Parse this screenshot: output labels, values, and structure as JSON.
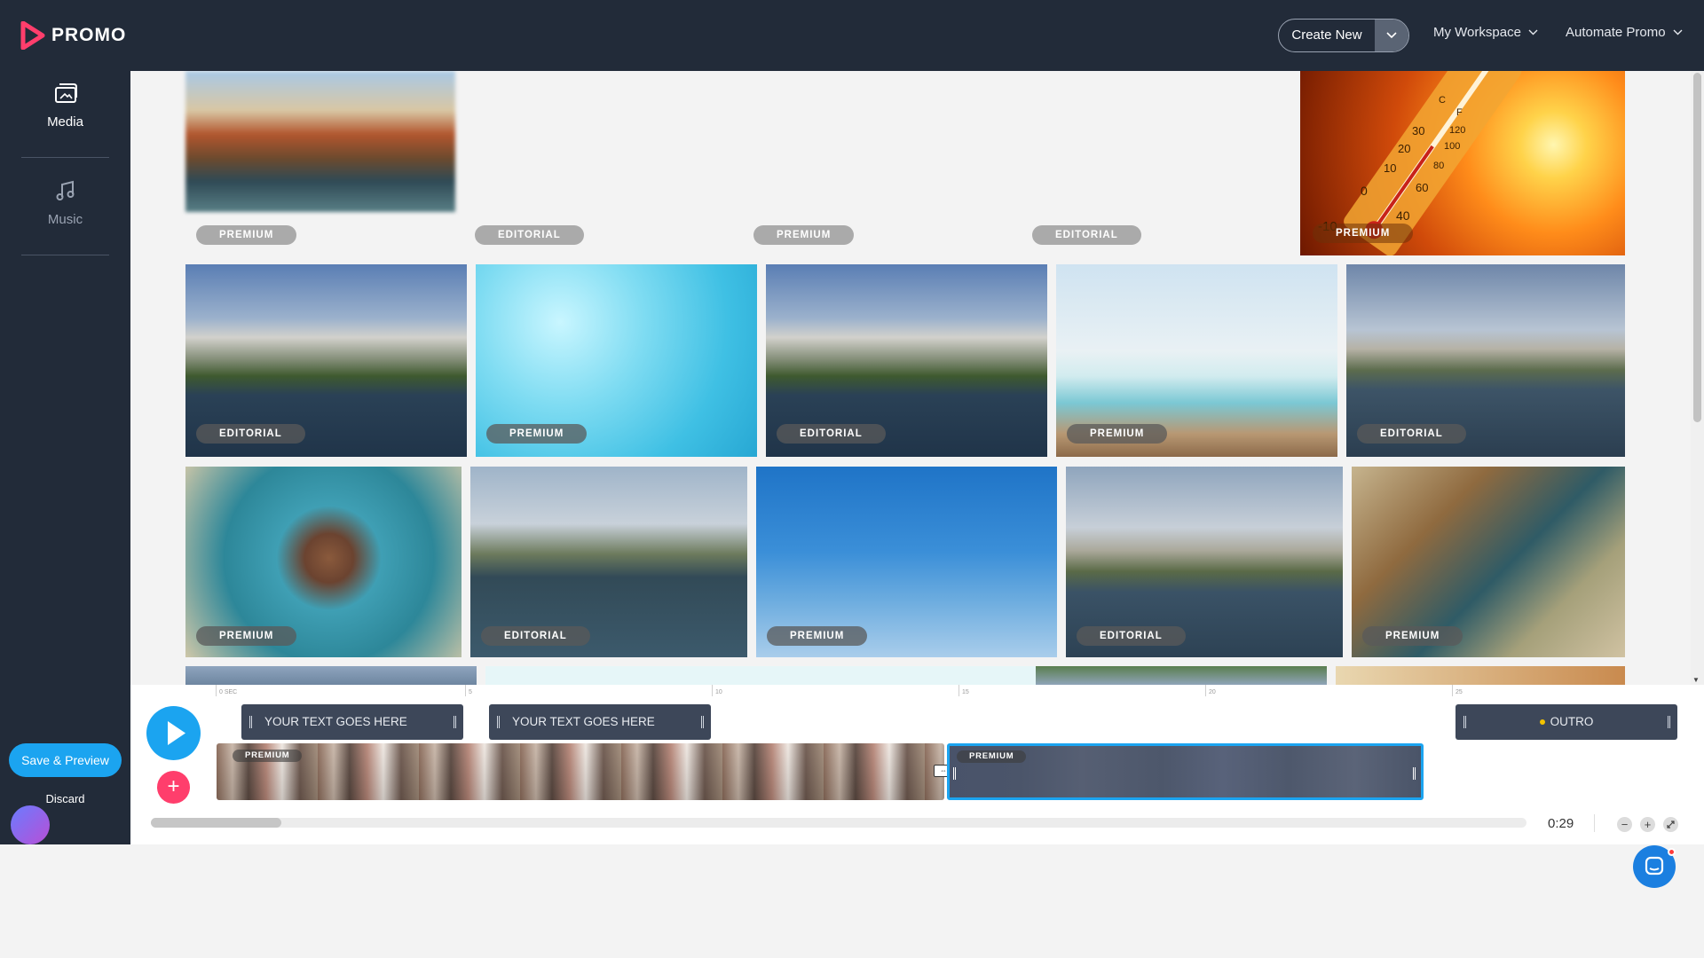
{
  "brand": {
    "name": "PROMO",
    "accent": "#ff3e6c"
  },
  "header": {
    "create_new": "Create New",
    "menus": [
      "My Workspace",
      "Automate Promo"
    ]
  },
  "sidebar": {
    "items": [
      {
        "label": "Media",
        "icon": "media-icon",
        "active": true
      },
      {
        "label": "Music",
        "icon": "music-icon",
        "active": false
      }
    ],
    "save_preview": "Save & Preview",
    "discard": "Discard"
  },
  "gallery": {
    "row1": [
      "PREMIUM",
      "EDITORIAL",
      "PREMIUM",
      "EDITORIAL",
      "PREMIUM"
    ],
    "row2": [
      "EDITORIAL",
      "PREMIUM",
      "EDITORIAL",
      "PREMIUM",
      "EDITORIAL"
    ],
    "row3": [
      "PREMIUM",
      "EDITORIAL",
      "PREMIUM",
      "EDITORIAL",
      "PREMIUM"
    ],
    "thermometer_marks": [
      "C",
      "F",
      "120",
      "30",
      "100",
      "20",
      "80",
      "10",
      "60",
      "0",
      "40",
      "-10"
    ]
  },
  "timeline": {
    "ruler": [
      "0 SEC",
      "5",
      "10",
      "15",
      "20",
      "25"
    ],
    "text_clips": [
      "YOUR TEXT GOES HERE",
      "YOUR TEXT GOES HERE"
    ],
    "outro": "OUTRO",
    "video_clip_badges": [
      "PREMIUM",
      "PREMIUM"
    ],
    "duration": "0:29",
    "zoom_out": "−",
    "zoom_in": "+"
  },
  "colors": {
    "nav_bg": "#222b39",
    "primary": "#1ba4f0",
    "add": "#ff3e6c"
  }
}
